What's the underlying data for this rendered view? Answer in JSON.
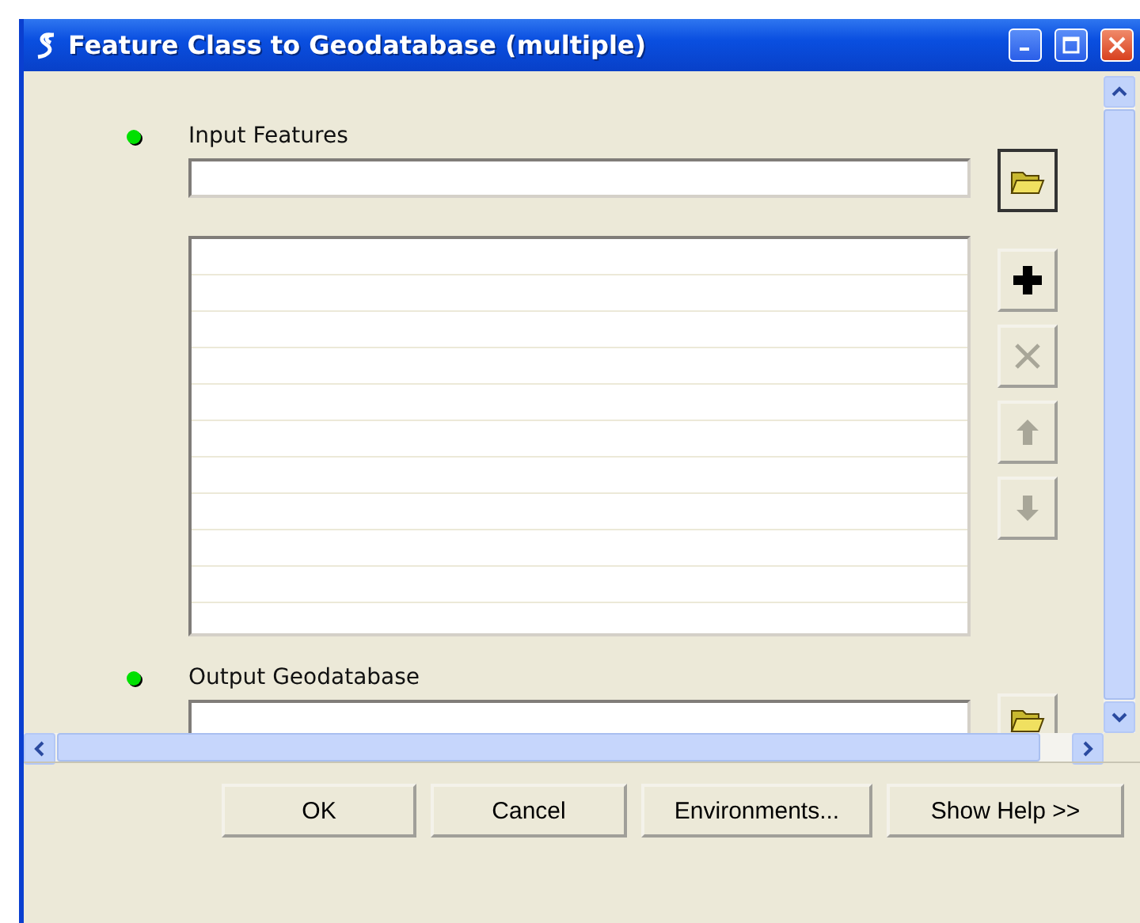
{
  "window": {
    "title": "Feature Class to Geodatabase (multiple)"
  },
  "input_features": {
    "label": "Input Features",
    "required": true
  },
  "list_buttons": [
    {
      "kind": "add",
      "disabled": false
    },
    {
      "kind": "remove",
      "disabled": true
    },
    {
      "kind": "up",
      "disabled": true
    },
    {
      "kind": "down",
      "disabled": true
    }
  ],
  "output_geodatabase": {
    "label": "Output Geodatabase",
    "required": true
  },
  "buttons": [
    "OK",
    "Cancel",
    "Environments...",
    "Show Help >>"
  ]
}
